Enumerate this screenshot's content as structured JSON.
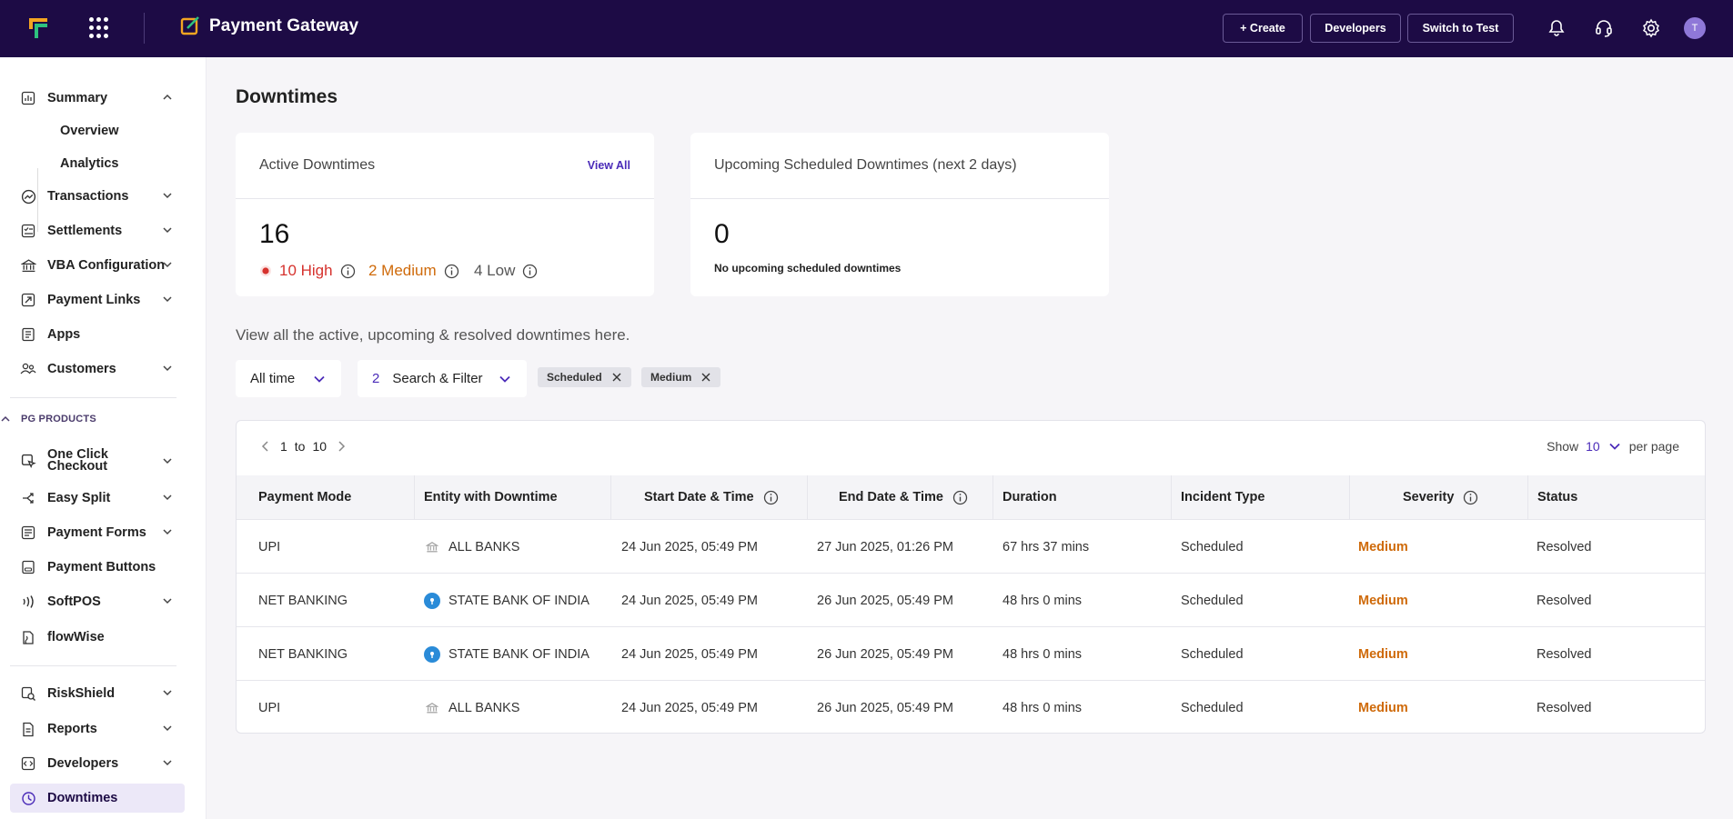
{
  "header": {
    "product_title": "Payment Gateway",
    "create_label": "+ Create",
    "developers_label": "Developers",
    "switch_label": "Switch to Test",
    "avatar_initial": "T"
  },
  "sidebar": {
    "summary": "Summary",
    "overview": "Overview",
    "analytics": "Analytics",
    "transactions": "Transactions",
    "settlements": "Settlements",
    "vba": "VBA Configuration",
    "payment_links": "Payment Links",
    "apps": "Apps",
    "customers": "Customers",
    "section": "PG PRODUCTS",
    "one_click_1": "One Click",
    "one_click_2": "Checkout",
    "easy_split": "Easy Split",
    "payment_forms": "Payment Forms",
    "payment_buttons": "Payment Buttons",
    "softpos": "SoftPOS",
    "flowwise": "flowWise",
    "riskshield": "RiskShield",
    "reports": "Reports",
    "developers": "Developers",
    "downtimes": "Downtimes"
  },
  "page": {
    "title": "Downtimes",
    "subtitle": "View all the active, upcoming & resolved downtimes here."
  },
  "active_card": {
    "title": "Active Downtimes",
    "view_all": "View All",
    "count": "16",
    "high": "10 High",
    "medium": "2 Medium",
    "low": "4 Low"
  },
  "upcoming_card": {
    "title": "Upcoming Scheduled Downtimes (next 2 days)",
    "count": "0",
    "note": "No upcoming scheduled downtimes"
  },
  "filters": {
    "time": "All time",
    "count": "2",
    "search": "Search & Filter",
    "chips": [
      "Scheduled",
      "Medium"
    ]
  },
  "table": {
    "pager_from": "1",
    "pager_to_word": "to",
    "pager_to": "10",
    "show": "Show",
    "per_page_value": "10",
    "per_page": "per page",
    "columns": [
      "Payment Mode",
      "Entity with Downtime",
      "Start Date & Time",
      "End Date & Time",
      "Duration",
      "Incident Type",
      "Severity",
      "Status"
    ],
    "rows": [
      {
        "mode": "UPI",
        "entity": "ALL BANKS",
        "entity_icon": "bank-icon",
        "start": "24 Jun 2025, 05:49 PM",
        "end": "27 Jun 2025, 01:26 PM",
        "duration": "67 hrs 37 mins",
        "type": "Scheduled",
        "severity": "Medium",
        "status": "Resolved"
      },
      {
        "mode": "NET BANKING",
        "entity": "STATE BANK OF INDIA",
        "entity_icon": "sbi-icon",
        "start": "24 Jun 2025, 05:49 PM",
        "end": "26 Jun 2025, 05:49 PM",
        "duration": "48 hrs 0 mins",
        "type": "Scheduled",
        "severity": "Medium",
        "status": "Resolved"
      },
      {
        "mode": "NET BANKING",
        "entity": "STATE BANK OF INDIA",
        "entity_icon": "sbi-icon",
        "start": "24 Jun 2025, 05:49 PM",
        "end": "26 Jun 2025, 05:49 PM",
        "duration": "48 hrs 0 mins",
        "type": "Scheduled",
        "severity": "Medium",
        "status": "Resolved"
      },
      {
        "mode": "UPI",
        "entity": "ALL BANKS",
        "entity_icon": "bank-icon",
        "start": "24 Jun 2025, 05:49 PM",
        "end": "26 Jun 2025, 05:49 PM",
        "duration": "48 hrs 0 mins",
        "type": "Scheduled",
        "severity": "Medium",
        "status": "Resolved"
      }
    ]
  },
  "colors": {
    "topbar": "#1d0b45",
    "accent": "#4a2bb8",
    "high": "#d6322d",
    "medium": "#cf6a0a"
  }
}
